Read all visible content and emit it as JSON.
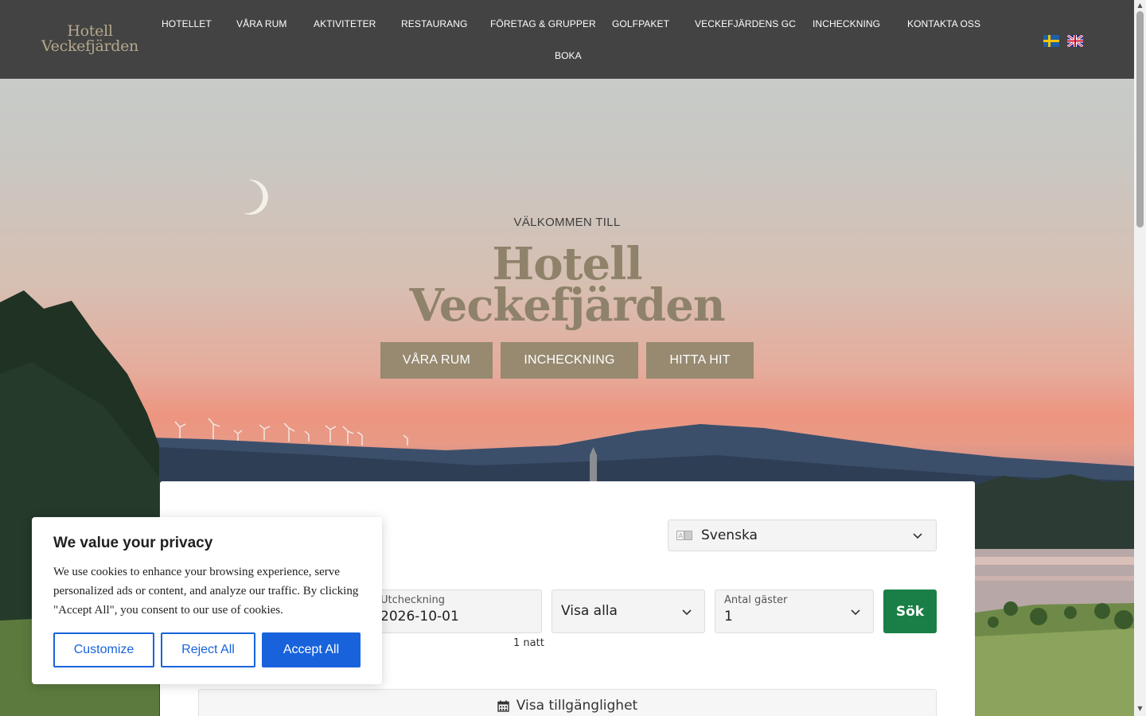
{
  "header": {
    "logo_line1": "Hotell",
    "logo_line2": "Veckefjärden",
    "nav": [
      "HOTELLET",
      "VÅRA RUM",
      "AKTIVITETER",
      "RESTAURANG",
      "FÖRETAG & GRUPPER",
      "GOLFPAKET",
      "VECKEFJÄRDENS GC",
      "INCHECKNING",
      "KONTAKTA OSS",
      "BOKA"
    ],
    "flags": [
      "swedish-flag-icon",
      "uk-flag-icon"
    ]
  },
  "hero": {
    "welcome": "VÄLKOMMEN TILL",
    "title_line1": "Hotell",
    "title_line2": "Veckefjärden",
    "buttons": [
      "VÅRA RUM",
      "INCHECKNING",
      "HITTA HIT"
    ]
  },
  "booking": {
    "language_selected": "Svenska",
    "checkout_label": "Utcheckning",
    "checkout_value": "2026-10-01",
    "nights": "1 natt",
    "room_filter": "Visa alla",
    "guests_label": "Antal gäster",
    "guests_value": "1",
    "search_label": "Sök",
    "availability_label": "Visa tillgänglighet"
  },
  "cookie": {
    "title": "We value your privacy",
    "text": "We use cookies to enhance your browsing experience, serve personalized ads or content, and analyze our traffic. By clicking \"Accept All\", you consent to our use of cookies.",
    "customize": "Customize",
    "reject": "Reject All",
    "accept": "Accept All"
  },
  "colors": {
    "header_bg": "#434343",
    "accent_gold": "#978a71",
    "search_green": "#1a7f46",
    "cookie_blue": "#1863dc"
  }
}
